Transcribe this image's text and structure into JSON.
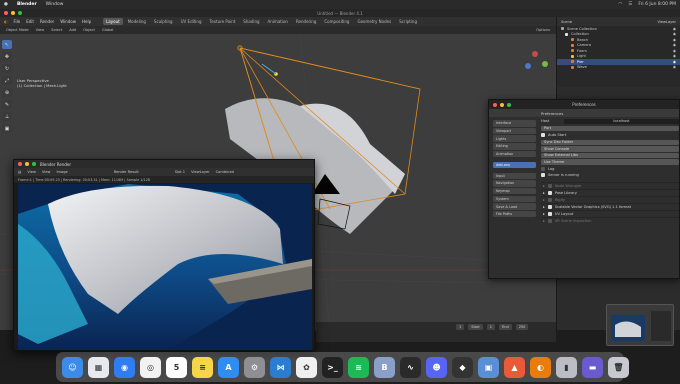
{
  "menubar": {
    "app": "Blender",
    "items": [
      "Window"
    ],
    "clock": "Fri 6 Jun 8:00 PM"
  },
  "window_title": "Untitled — Blender 4.1",
  "topbar": {
    "menus": [
      "File",
      "Edit",
      "Render",
      "Window",
      "Help"
    ],
    "workspaces": [
      "Layout",
      "Modeling",
      "Sculpting",
      "UV Editing",
      "Texture Paint",
      "Shading",
      "Animation",
      "Rendering",
      "Compositing",
      "Geometry Nodes",
      "Scripting"
    ],
    "active_workspace": "Layout",
    "scene": "Scene",
    "view_layer": "ViewLayer"
  },
  "viewport_header": {
    "mode": "Object Mode",
    "menus": [
      "View",
      "Select",
      "Add",
      "Object"
    ],
    "orientation": "Global",
    "options": "Options"
  },
  "viewport_info": {
    "line1": "User Perspective",
    "line2": "(1) Collection | Mesh.Light"
  },
  "toolbar": {
    "icons": [
      "cursor-icon",
      "move-icon",
      "rotate-icon",
      "scale-icon",
      "transform-icon",
      "annotate-icon",
      "measure-icon",
      "add-cube-icon"
    ]
  },
  "outliner": {
    "title": "Scene Collection",
    "rows": [
      {
        "label": "Scene Collection",
        "color": "#a8a8a8",
        "selected": false
      },
      {
        "label": "Collection",
        "color": "#e6e6e6",
        "selected": false
      },
      {
        "label": "Beach",
        "color": "#e07a3a",
        "selected": false
      },
      {
        "label": "Camera",
        "color": "#e07a3a",
        "selected": false
      },
      {
        "label": "Foam",
        "color": "#e07a3a",
        "selected": false
      },
      {
        "label": "Light",
        "color": "#e0c83a",
        "selected": false
      },
      {
        "label": "Pier",
        "color": "#e07a3a",
        "selected": true
      },
      {
        "label": "Wave",
        "color": "#e07a3a",
        "selected": false
      }
    ]
  },
  "preferences": {
    "title": "Preferences",
    "header": "Preferences",
    "categories": [
      "Interface",
      "Viewport",
      "Lights",
      "Editing",
      "Animation",
      "Add-ons",
      "Input",
      "Navigation",
      "Keymap",
      "System",
      "Save & Load",
      "File Paths"
    ],
    "active_category": "Add-ons",
    "host_label": "Host",
    "host_value": "localhost",
    "port_label": "Port",
    "auto_start": "Auto Start",
    "buttons": [
      "Sync Dev Folder",
      "Show Console",
      "Show External Libs",
      "Use Theme"
    ],
    "log_label": "Log",
    "server_status": "Server is running",
    "panels": [
      {
        "label": "Node Wrangler",
        "enabled": false
      },
      {
        "label": "Pose Library",
        "enabled": true
      },
      {
        "label": "Rigify",
        "enabled": false
      },
      {
        "label": "Scalable Vector Graphics (SVG) 1.1 format",
        "enabled": true
      },
      {
        "label": "UV Layout",
        "enabled": true
      },
      {
        "label": "VR Scene Inspection",
        "enabled": false
      }
    ]
  },
  "render_window": {
    "title": "Blender Render",
    "menus": [
      "View",
      "View",
      "Image"
    ],
    "slot": "Render Result",
    "slot_number": "Slot 1",
    "view_layer": "ViewLayer",
    "combined": "Combined",
    "status": "Frame:1 | Time:00:09.23 | Rendering: 00:03.51 | Mem: 1116M | Sample 1/128"
  },
  "timeline": {
    "frame": "1",
    "start_label": "Start",
    "start_value": "1",
    "end_label": "End",
    "end_value": "250"
  },
  "dock": {
    "icons": [
      {
        "name": "finder-icon",
        "color": "#3d8be8",
        "glyph": "☺"
      },
      {
        "name": "launchpad-icon",
        "color": "#e8e8ef",
        "glyph": "▦"
      },
      {
        "name": "safari-icon",
        "color": "#2f7df0",
        "glyph": "◉"
      },
      {
        "name": "chrome-icon",
        "color": "#f2f2f2",
        "glyph": "◎"
      },
      {
        "name": "calendar-icon",
        "color": "#ffffff",
        "glyph": "5"
      },
      {
        "name": "notes-icon",
        "color": "#f5d54a",
        "glyph": "≡"
      },
      {
        "name": "app-store-icon",
        "color": "#2d8df0",
        "glyph": "A"
      },
      {
        "name": "settings-icon",
        "color": "#8e8e93",
        "glyph": "⚙"
      },
      {
        "name": "vscode-icon",
        "color": "#2a7dd1",
        "glyph": "⋈"
      },
      {
        "name": "photos-icon",
        "color": "#f0f0f0",
        "glyph": "✿"
      },
      {
        "name": "terminal-icon",
        "color": "#222222",
        "glyph": ">_"
      },
      {
        "name": "spotify-icon",
        "color": "#1db954",
        "glyph": "≋"
      },
      {
        "name": "bbedit-icon",
        "color": "#8aa0c8",
        "glyph": "B"
      },
      {
        "name": "activity-icon",
        "color": "#2a2a2a",
        "glyph": "∿"
      },
      {
        "name": "discord-icon",
        "color": "#5865f2",
        "glyph": "☻"
      },
      {
        "name": "unity-icon",
        "color": "#333333",
        "glyph": "◆"
      },
      {
        "name": "preview-icon",
        "color": "#5a8fd8",
        "glyph": "▣"
      },
      {
        "name": "mockup-icon",
        "color": "#e85a3a",
        "glyph": "▲"
      },
      {
        "name": "blender-icon",
        "color": "#e87d0d",
        "glyph": "◐"
      },
      {
        "name": "folder-icon",
        "color": "#bcbcc4",
        "glyph": "▮"
      },
      {
        "name": "downloads-icon",
        "color": "#6a5acd",
        "glyph": "▬"
      },
      {
        "name": "trash-icon",
        "color": "#c8c8d0",
        "glyph": "🗑"
      }
    ]
  },
  "colors": {
    "accent": "#4772b3",
    "camera_lines": "#e08a1e"
  }
}
